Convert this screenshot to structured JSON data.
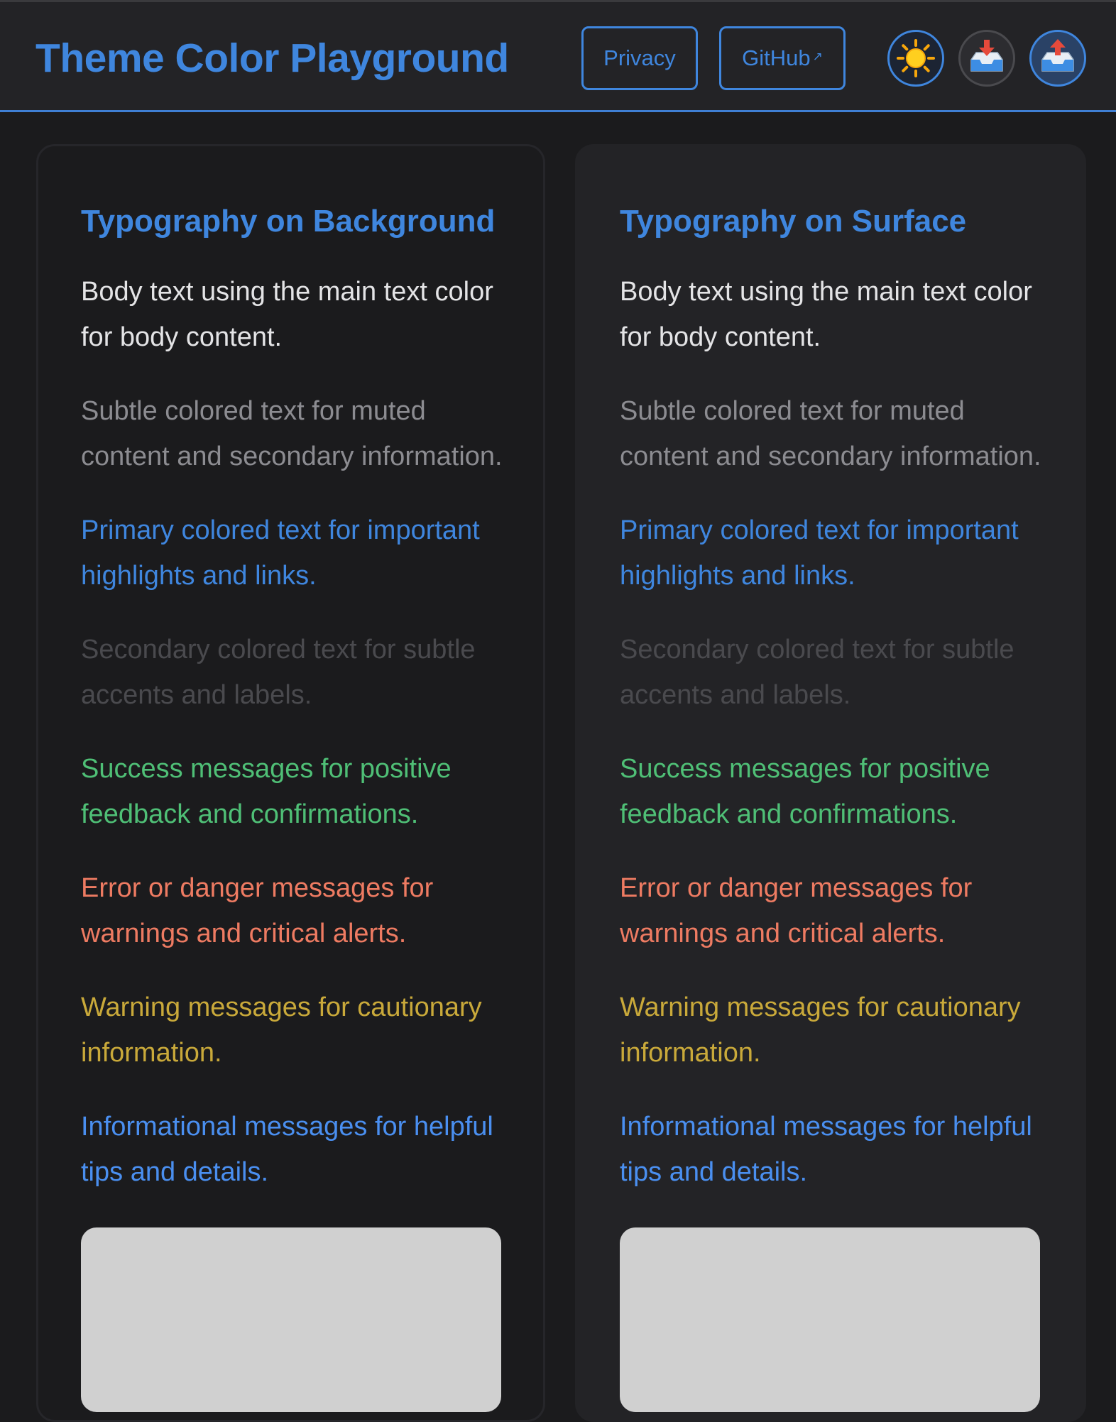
{
  "header": {
    "title": "Theme Color Playground",
    "privacy_label": "Privacy",
    "github_label": "GitHub",
    "github_ext_mark": "↗"
  },
  "icons": {
    "theme_toggle": "sun-icon",
    "import": "inbox-tray-download-icon",
    "export": "outbox-tray-upload-icon"
  },
  "colors": {
    "primary": "#3f86de",
    "text": "#e4e4e6",
    "subtle": "#8c8c91",
    "secondary": "#4a4a4e",
    "success": "#4fbf76",
    "danger": "#ee7b62",
    "warning": "#c9a93a",
    "info": "#4a8ff0",
    "background": "#1b1b1d",
    "surface": "#232326"
  },
  "cards": [
    {
      "title": "Typography on Background",
      "body": "Body text using the main text color for body content.",
      "subtle": "Subtle colored text for muted content and secondary information.",
      "primary": "Primary colored text for important highlights and links.",
      "secondary": "Secondary colored text for subtle accents and labels.",
      "success": "Success messages for positive feedback and confirmations.",
      "danger": "Error or danger messages for warnings and critical alerts.",
      "warning": "Warning messages for cautionary information.",
      "info": "Informational messages for helpful tips and details."
    },
    {
      "title": "Typography on Surface",
      "body": "Body text using the main text color for body content.",
      "subtle": "Subtle colored text for muted content and secondary information.",
      "primary": "Primary colored text for important highlights and links.",
      "secondary": "Secondary colored text for subtle accents and labels.",
      "success": "Success messages for positive feedback and confirmations.",
      "danger": "Error or danger messages for warnings and critical alerts.",
      "warning": "Warning messages for cautionary information.",
      "info": "Informational messages for helpful tips and details."
    }
  ]
}
